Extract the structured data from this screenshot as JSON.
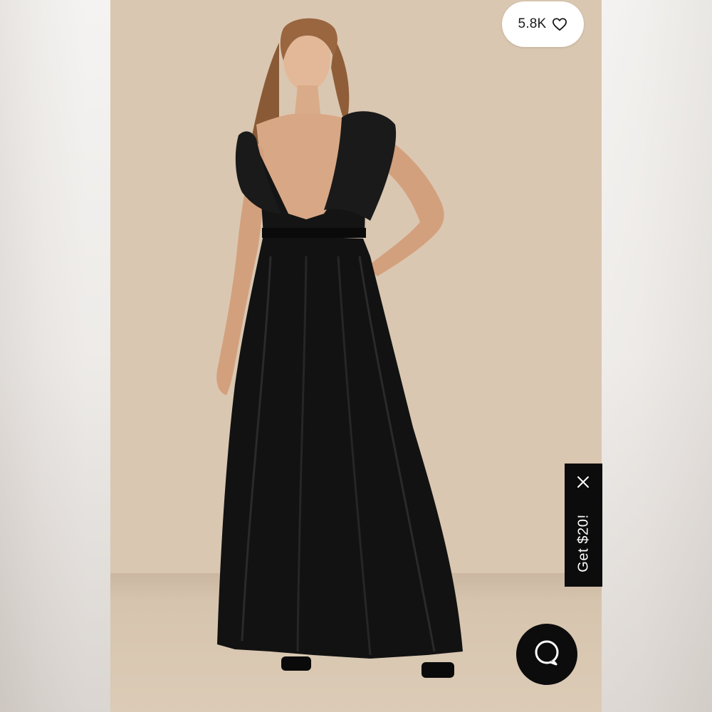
{
  "listing": {
    "likes_count": "5.8K",
    "like_icon": "heart-outline-icon"
  },
  "promo": {
    "label": "Get $20!",
    "close_icon": "close-icon"
  },
  "chat": {
    "icon": "chat-bubble-icon"
  },
  "colors": {
    "backdrop": "#dac7b1",
    "dress": "#111111",
    "promo_bg": "#0c0c0c",
    "chat_bg": "#0c0c0c"
  }
}
